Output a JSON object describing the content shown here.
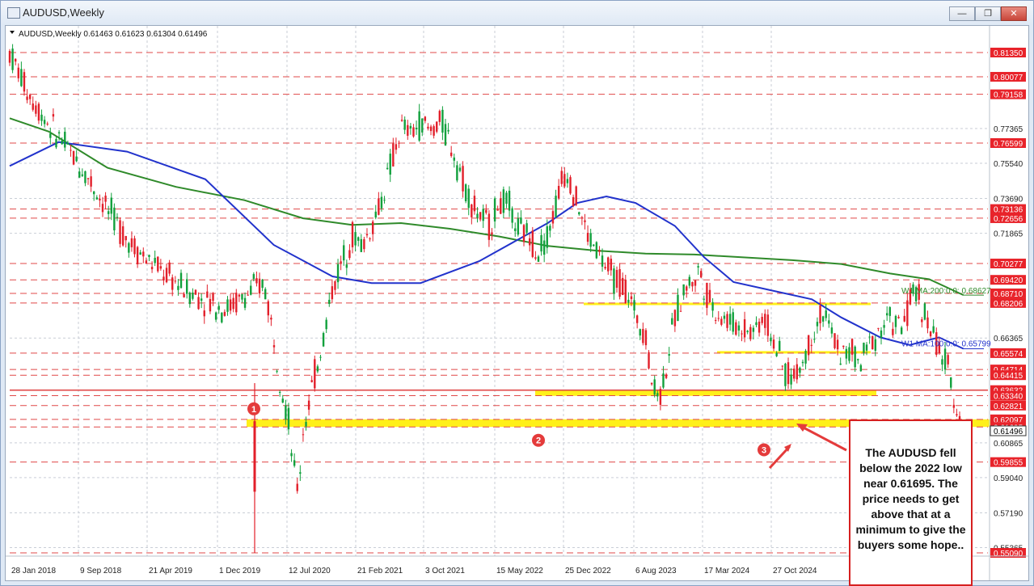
{
  "window": {
    "title": "AUDUSD,Weekly",
    "controls": [
      "minimize",
      "restore",
      "close"
    ]
  },
  "chart_info": {
    "header": "AUDUSD,Weekly  0.61463 0.61623 0.61304 0.61496"
  },
  "chart_data": {
    "type": "candlestick",
    "symbol": "AUDUSD",
    "timeframe": "Weekly",
    "ylim": [
      0.5509,
      0.8135
    ],
    "price_scale_ticks": [
      {
        "price": 0.7736,
        "label": "0.77365"
      },
      {
        "price": 0.7554,
        "label": "0.75540"
      },
      {
        "price": 0.7369,
        "label": "0.73690"
      },
      {
        "price": 0.71865,
        "label": "0.71865"
      },
      {
        "price": 0.66365,
        "label": "0.66365"
      },
      {
        "price": 0.60865,
        "label": "0.60865"
      },
      {
        "price": 0.5904,
        "label": "0.59040"
      },
      {
        "price": 0.5719,
        "label": "0.57190"
      },
      {
        "price": 0.55365,
        "label": "0.55365"
      }
    ],
    "horizontal_levels": [
      {
        "price": 0.8135,
        "label": "0.81350"
      },
      {
        "price": 0.80077,
        "label": "0.80077"
      },
      {
        "price": 0.79158,
        "label": "0.79158"
      },
      {
        "price": 0.76599,
        "label": "0.76599"
      },
      {
        "price": 0.73136,
        "label": "0.73136"
      },
      {
        "price": 0.72656,
        "label": "0.72656"
      },
      {
        "price": 0.70277,
        "label": "0.70277"
      },
      {
        "price": 0.6942,
        "label": "0.69420"
      },
      {
        "price": 0.6871,
        "label": "0.68710"
      },
      {
        "price": 0.68206,
        "label": "0.68206"
      },
      {
        "price": 0.65574,
        "label": "0.65574"
      },
      {
        "price": 0.64714,
        "label": "0.64714"
      },
      {
        "price": 0.64415,
        "label": "0.64415"
      },
      {
        "price": 0.63632,
        "label": "0.63632"
      },
      {
        "price": 0.6334,
        "label": "0.63340"
      },
      {
        "price": 0.62821,
        "label": "0.62821"
      },
      {
        "price": 0.62097,
        "label": "0.62097"
      },
      {
        "price": 0.61695,
        "label": "0.61695"
      },
      {
        "price": 0.59855,
        "label": "0.59855"
      },
      {
        "price": 0.5509,
        "label": "0.55090"
      }
    ],
    "current_price": {
      "price": 0.61496,
      "label": "0.61496"
    },
    "x_ticks": [
      "28 Jan 2018",
      "9 Sep 2018",
      "21 Apr 2019",
      "1 Dec 2019",
      "12 Jul 2020",
      "21 Feb 2021",
      "3 Oct 2021",
      "15 May 2022",
      "25 Dec 2022",
      "6 Aug 2023",
      "17 Mar 2024",
      "27 Oct 2024"
    ],
    "ma_labels": {
      "ma200": "W1 MA:200:0:0: 0.68627",
      "ma100": "W1 MA:100:0:0: 0.65799"
    },
    "price_path": [
      [
        0.0,
        0.8135
      ],
      [
        0.02,
        0.7915
      ],
      [
        0.04,
        0.776
      ],
      [
        0.06,
        0.762
      ],
      [
        0.08,
        0.748
      ],
      [
        0.1,
        0.731
      ],
      [
        0.12,
        0.716
      ],
      [
        0.14,
        0.705
      ],
      [
        0.16,
        0.697
      ],
      [
        0.18,
        0.689
      ],
      [
        0.2,
        0.684
      ],
      [
        0.22,
        0.679
      ],
      [
        0.24,
        0.685
      ],
      [
        0.26,
        0.693
      ],
      [
        0.27,
        0.664
      ],
      [
        0.28,
        0.633
      ],
      [
        0.285,
        0.62
      ],
      [
        0.29,
        0.595
      ],
      [
        0.295,
        0.583
      ],
      [
        0.3,
        0.615
      ],
      [
        0.31,
        0.64
      ],
      [
        0.32,
        0.662
      ],
      [
        0.33,
        0.69
      ],
      [
        0.34,
        0.704
      ],
      [
        0.35,
        0.718
      ],
      [
        0.36,
        0.712
      ],
      [
        0.37,
        0.722
      ],
      [
        0.38,
        0.7365
      ],
      [
        0.39,
        0.755
      ],
      [
        0.4,
        0.774
      ],
      [
        0.41,
        0.771
      ],
      [
        0.42,
        0.777
      ],
      [
        0.43,
        0.772
      ],
      [
        0.44,
        0.778
      ],
      [
        0.45,
        0.767
      ],
      [
        0.46,
        0.752
      ],
      [
        0.47,
        0.737
      ],
      [
        0.48,
        0.728
      ],
      [
        0.49,
        0.722
      ],
      [
        0.5,
        0.735
      ],
      [
        0.51,
        0.733
      ],
      [
        0.52,
        0.72
      ],
      [
        0.53,
        0.718
      ],
      [
        0.54,
        0.71
      ],
      [
        0.55,
        0.718
      ],
      [
        0.56,
        0.737
      ],
      [
        0.565,
        0.748
      ],
      [
        0.57,
        0.752
      ],
      [
        0.58,
        0.735
      ],
      [
        0.59,
        0.718
      ],
      [
        0.6,
        0.71
      ],
      [
        0.61,
        0.7
      ],
      [
        0.62,
        0.694
      ],
      [
        0.63,
        0.69
      ],
      [
        0.64,
        0.675
      ],
      [
        0.65,
        0.668
      ],
      [
        0.655,
        0.643
      ],
      [
        0.66,
        0.637
      ],
      [
        0.665,
        0.634
      ],
      [
        0.67,
        0.646
      ],
      [
        0.68,
        0.674
      ],
      [
        0.69,
        0.69
      ],
      [
        0.7,
        0.694
      ],
      [
        0.705,
        0.7
      ],
      [
        0.71,
        0.69
      ],
      [
        0.72,
        0.679
      ],
      [
        0.73,
        0.674
      ],
      [
        0.74,
        0.671
      ],
      [
        0.75,
        0.669
      ],
      [
        0.76,
        0.668
      ],
      [
        0.77,
        0.675
      ],
      [
        0.78,
        0.664
      ],
      [
        0.79,
        0.648
      ],
      [
        0.8,
        0.642
      ],
      [
        0.81,
        0.65
      ],
      [
        0.82,
        0.665
      ],
      [
        0.83,
        0.678
      ],
      [
        0.84,
        0.666
      ],
      [
        0.85,
        0.655
      ],
      [
        0.86,
        0.656
      ],
      [
        0.87,
        0.65
      ],
      [
        0.88,
        0.662
      ],
      [
        0.89,
        0.669
      ],
      [
        0.9,
        0.674
      ],
      [
        0.91,
        0.668
      ],
      [
        0.92,
        0.68
      ],
      [
        0.925,
        0.6895
      ],
      [
        0.93,
        0.685
      ],
      [
        0.94,
        0.669
      ],
      [
        0.95,
        0.658
      ],
      [
        0.96,
        0.645
      ],
      [
        0.965,
        0.634
      ],
      [
        0.97,
        0.624
      ],
      [
        0.975,
        0.6158
      ],
      [
        0.98,
        0.615
      ]
    ],
    "ma100_path": [
      [
        0.0,
        0.754
      ],
      [
        0.05,
        0.7665
      ],
      [
        0.12,
        0.7615
      ],
      [
        0.2,
        0.747
      ],
      [
        0.27,
        0.7125
      ],
      [
        0.33,
        0.696
      ],
      [
        0.37,
        0.6925
      ],
      [
        0.42,
        0.6925
      ],
      [
        0.48,
        0.704
      ],
      [
        0.55,
        0.724
      ],
      [
        0.58,
        0.7345
      ],
      [
        0.61,
        0.738
      ],
      [
        0.64,
        0.7345
      ],
      [
        0.68,
        0.7225
      ],
      [
        0.71,
        0.706
      ],
      [
        0.74,
        0.693
      ],
      [
        0.78,
        0.6885
      ],
      [
        0.82,
        0.684
      ],
      [
        0.85,
        0.6745
      ],
      [
        0.89,
        0.664
      ],
      [
        0.92,
        0.66
      ],
      [
        0.95,
        0.664
      ],
      [
        0.975,
        0.658
      ]
    ],
    "ma200_path": [
      [
        0.0,
        0.779
      ],
      [
        0.04,
        0.772
      ],
      [
        0.1,
        0.753
      ],
      [
        0.17,
        0.743
      ],
      [
        0.24,
        0.736
      ],
      [
        0.3,
        0.7265
      ],
      [
        0.35,
        0.723
      ],
      [
        0.4,
        0.724
      ],
      [
        0.45,
        0.721
      ],
      [
        0.5,
        0.717
      ],
      [
        0.55,
        0.712
      ],
      [
        0.6,
        0.7095
      ],
      [
        0.65,
        0.708
      ],
      [
        0.7,
        0.7075
      ],
      [
        0.75,
        0.706
      ],
      [
        0.8,
        0.7045
      ],
      [
        0.85,
        0.7025
      ],
      [
        0.9,
        0.6975
      ],
      [
        0.94,
        0.6945
      ],
      [
        0.975,
        0.6862
      ]
    ],
    "highlight_zones": [
      {
        "from": 0.6817,
        "to": 0.6822
      },
      {
        "from": 0.6558,
        "to": 0.6568
      },
      {
        "from": 0.6333,
        "to": 0.6363
      },
      {
        "from": 0.617,
        "to": 0.621
      }
    ],
    "markers": [
      {
        "label": "1",
        "price": 0.6265
      },
      {
        "label": "2",
        "price": 0.61
      },
      {
        "label": "3",
        "price": 0.605
      }
    ]
  },
  "callout": {
    "text": "The AUDUSD fell below the 2022 low near 0.61695. The price needs to get above that at a minimum to give the buyers some hope.."
  },
  "colors": {
    "bull": "#11a03c",
    "bear": "#e21f2a",
    "ma100": "#2233cc",
    "ma200": "#2f8a2a",
    "level_line": "#e04848",
    "level_box": "#e8232a",
    "zone": "#ffee00",
    "grid": "#c9ced6"
  }
}
